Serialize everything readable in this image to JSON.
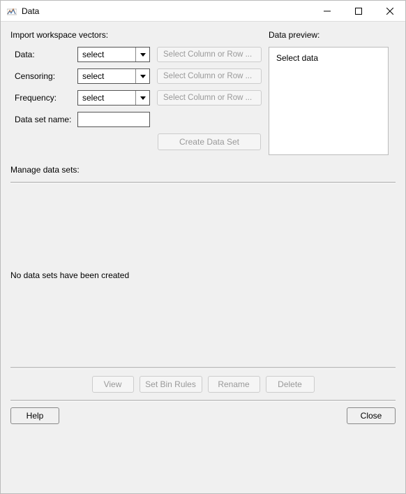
{
  "window": {
    "title": "Data"
  },
  "import": {
    "heading": "Import workspace vectors:",
    "rows": {
      "data": {
        "label": "Data:",
        "select_value": "select",
        "col_btn": "Select Column or Row ..."
      },
      "censoring": {
        "label": "Censoring:",
        "select_value": "select",
        "col_btn": "Select Column or Row ..."
      },
      "frequency": {
        "label": "Frequency:",
        "select_value": "select",
        "col_btn": "Select Column or Row ..."
      },
      "name": {
        "label": "Data set name:",
        "value": ""
      }
    },
    "create_btn": "Create Data Set"
  },
  "preview": {
    "heading": "Data preview:",
    "content": "Select data"
  },
  "manage": {
    "heading": "Manage data sets:",
    "empty_text": "No data sets have been created",
    "actions": {
      "view": "View",
      "set_bin_rules": "Set Bin Rules",
      "rename": "Rename",
      "delete": "Delete"
    }
  },
  "footer": {
    "help": "Help",
    "close": "Close"
  }
}
